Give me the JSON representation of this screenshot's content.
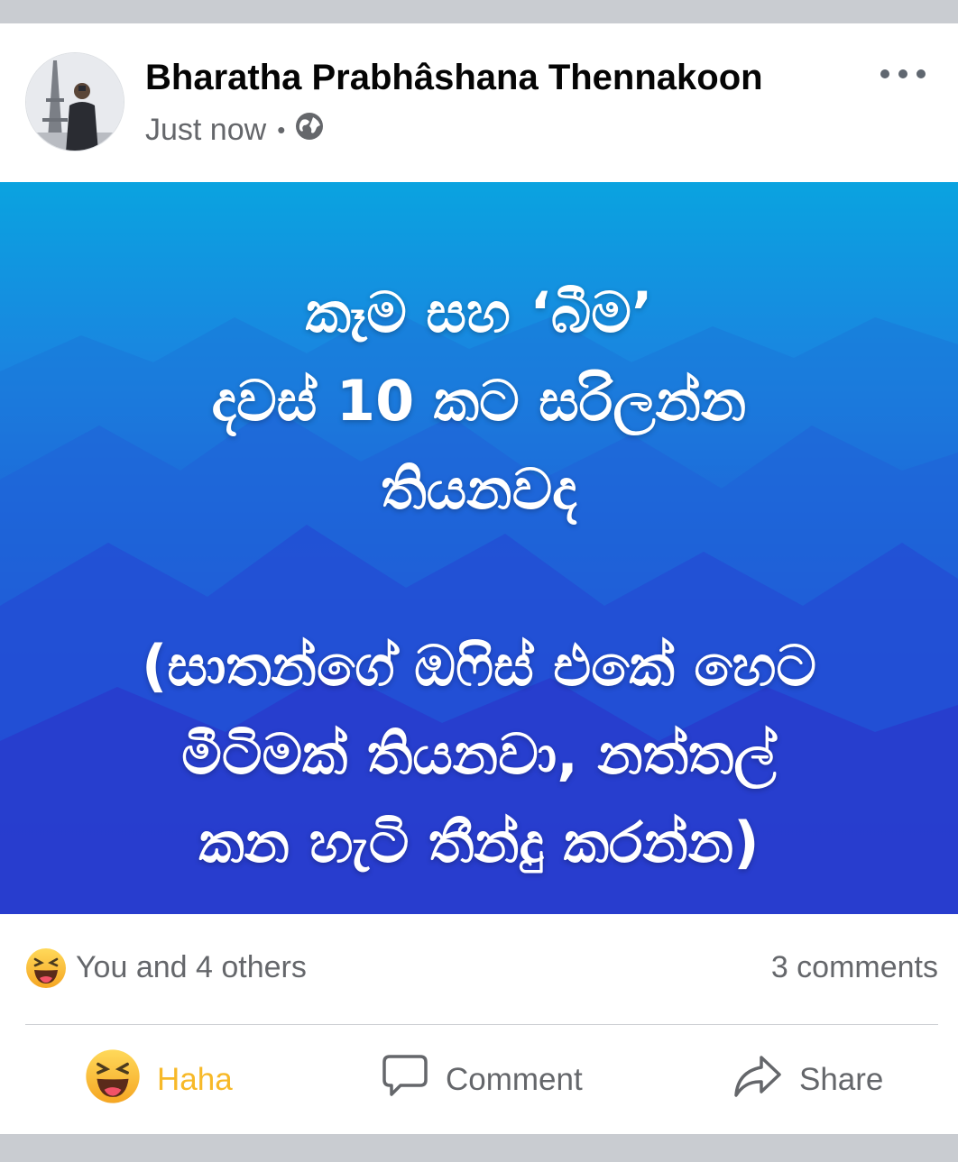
{
  "post": {
    "author": "Bharatha Prabhâshana Thennakoon",
    "time": "Just now",
    "separator": "•",
    "privacy_icon": "globe-icon",
    "menu_icon": "more-options-icon",
    "banner_text": "කෑම සහ ‘බීම’\nදවස් 10 කට සරිලන්න\nතියනවද\n\n(සාතන්ගේ ඔෆිස් එකේ හෙට\nමීටිමක් තියනවා, නත්තල්\nකන හැටි තීන්දු කරන්න)",
    "banner_colors": {
      "top": "#0aa3e0",
      "bottom": "#2f2fd2"
    }
  },
  "stats": {
    "reaction_icon": "haha-emoji-icon",
    "reactors": "You and 4 others",
    "comments": "3 comments"
  },
  "actions": {
    "haha_label": "Haha",
    "comment_label": "Comment",
    "share_label": "Share"
  },
  "colors": {
    "haha": "#f7b928",
    "secondary_text": "#65676b",
    "background": "#c9ccd1"
  }
}
